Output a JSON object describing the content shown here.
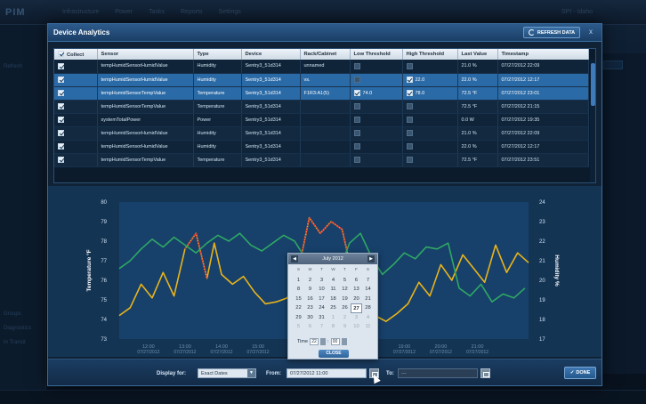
{
  "background": {
    "logo": "PIM",
    "tabs": [
      "Infrastructure",
      "Power",
      "Tasks",
      "Reports",
      "Settings"
    ],
    "user": "SPI - Idaho",
    "sidebar_items": [
      "Refresh",
      "Groups",
      "Diagnostics",
      "In Transit"
    ]
  },
  "modal": {
    "title": "Device Analytics",
    "refresh_label": "REFRESH DATA",
    "close_label": "x"
  },
  "table": {
    "headers": [
      "Collect",
      "Sensor",
      "Type",
      "Device",
      "Rack/Cabinet",
      "Low Threshold",
      "High Threshold",
      "Last Value",
      "Timestamp"
    ],
    "rows": [
      {
        "collect": true,
        "sensor": "tempHumidSensorHumidValue",
        "type": "Humidity",
        "device": "Sentry3_51d314",
        "rack": "unnamed",
        "low_on": false,
        "low": "",
        "high_on": false,
        "high": "",
        "last": "21.0 %",
        "time": "07/27/2012 22:09",
        "selected": false
      },
      {
        "collect": true,
        "sensor": "tempHumidSensorHumidValue",
        "type": "Humidity",
        "device": "Sentry3_51d314",
        "rack": "vs.",
        "low_on": false,
        "low": "",
        "high_on": true,
        "high": "22.0",
        "last": "22.0 %",
        "time": "07/27/2012 12:17",
        "selected": true
      },
      {
        "collect": true,
        "sensor": "tempHumidSensorTempValue",
        "type": "Temperature",
        "device": "Sentry3_51d314",
        "rack": "F1R3:A1(5)",
        "low_on": true,
        "low": "74.0",
        "high_on": true,
        "high": "78.0",
        "last": "72.5 °F",
        "time": "07/27/2012 23:01",
        "selected": true
      },
      {
        "collect": true,
        "sensor": "tempHumidSensorTempValue",
        "type": "Temperature",
        "device": "Sentry3_51d314",
        "rack": "",
        "low_on": false,
        "low": "",
        "high_on": false,
        "high": "",
        "last": "72.5 °F",
        "time": "07/27/2012 21:15",
        "selected": false
      },
      {
        "collect": true,
        "sensor": "systemTotalPower",
        "type": "Power",
        "device": "Sentry3_51d314",
        "rack": "",
        "low_on": false,
        "low": "",
        "high_on": false,
        "high": "",
        "last": "0.0 W",
        "time": "07/27/2012 19:35",
        "selected": false
      },
      {
        "collect": true,
        "sensor": "tempHumidSensorHumidValue",
        "type": "Humidity",
        "device": "Sentry3_51d314",
        "rack": "",
        "low_on": false,
        "low": "",
        "high_on": false,
        "high": "",
        "last": "21.0 %",
        "time": "07/27/2012 22:09",
        "selected": false
      },
      {
        "collect": true,
        "sensor": "tempHumidSensorHumidValue",
        "type": "Humidity",
        "device": "Sentry3_51d314",
        "rack": "",
        "low_on": false,
        "low": "",
        "high_on": false,
        "high": "",
        "last": "22.0 %",
        "time": "07/27/2012 12:17",
        "selected": false
      },
      {
        "collect": true,
        "sensor": "tempHumidSensorTempValue",
        "type": "Temperature",
        "device": "Sentry3_51d314",
        "rack": "",
        "low_on": false,
        "low": "",
        "high_on": false,
        "high": "",
        "last": "72.5 °F",
        "time": "07/27/2012 23:51",
        "selected": false
      }
    ]
  },
  "chart_data": {
    "type": "line",
    "ylabel": "Temperature °F",
    "y2label": "Humidity %",
    "ylim": [
      73,
      80
    ],
    "y2lim": [
      17,
      24
    ],
    "yticks": [
      73,
      74,
      75,
      76,
      77,
      78,
      79,
      80
    ],
    "y2ticks": [
      17,
      18,
      19,
      20,
      21,
      22,
      23,
      24
    ],
    "xticks": [
      {
        "t": 12.0,
        "time": "12:00",
        "date": "07/27/2012"
      },
      {
        "t": 13.0,
        "time": "13:00",
        "date": "07/27/2012"
      },
      {
        "t": 14.0,
        "time": "14:00",
        "date": "07/27/2012"
      },
      {
        "t": 15.0,
        "time": "15:00",
        "date": "07/27/2012"
      },
      {
        "t": 19.0,
        "time": "19:00",
        "date": "07/27/2012"
      },
      {
        "t": 20.0,
        "time": "20:00",
        "date": "07/27/2012"
      },
      {
        "t": 21.0,
        "time": "21:00",
        "date": "07/27/2012"
      }
    ],
    "xlim": [
      11.2,
      22.4
    ],
    "series": [
      {
        "name": "tempHumidSensorTempValue",
        "axis": "left",
        "color": "#e8b41c",
        "x": [
          11.2,
          11.5,
          11.8,
          12.1,
          12.4,
          12.7,
          13.0,
          13.3,
          13.6,
          13.8,
          14.0,
          14.3,
          14.6,
          14.9,
          15.2,
          15.5,
          15.8,
          16.1,
          16.4,
          16.7,
          17.0,
          17.3,
          17.6,
          17.9,
          18.2,
          18.5,
          18.8,
          19.1,
          19.4,
          19.7,
          20.0,
          20.3,
          20.6,
          20.9,
          21.2,
          21.5,
          21.8,
          22.1,
          22.4
        ],
        "y": [
          74.2,
          74.6,
          75.8,
          75.1,
          76.4,
          75.2,
          77.6,
          78.4,
          76.1,
          77.9,
          76.3,
          75.8,
          76.2,
          75.4,
          74.8,
          74.9,
          75.1,
          76.5,
          79.2,
          78.4,
          79.0,
          78.6,
          76.1,
          75.4,
          74.2,
          73.9,
          74.3,
          74.8,
          75.9,
          75.2,
          76.8,
          76.0,
          77.3,
          76.6,
          75.9,
          77.8,
          76.4,
          77.4,
          76.9
        ]
      },
      {
        "name": "tempHumidSensorHumidValue",
        "axis": "right",
        "color": "#2fa864",
        "x": [
          11.2,
          11.5,
          11.8,
          12.1,
          12.4,
          12.7,
          13.0,
          13.3,
          13.6,
          13.9,
          14.2,
          14.5,
          14.8,
          15.1,
          15.4,
          15.7,
          16.0,
          16.3,
          16.6,
          16.9,
          17.2,
          17.5,
          17.8,
          18.1,
          18.4,
          18.7,
          19.0,
          19.3,
          19.6,
          19.9,
          20.2,
          20.5,
          20.8,
          21.1,
          21.4,
          21.7,
          22.0,
          22.3
        ],
        "y": [
          20.6,
          21.0,
          21.6,
          22.1,
          21.7,
          22.2,
          21.8,
          21.4,
          21.9,
          22.3,
          22.0,
          22.4,
          21.8,
          21.5,
          21.9,
          22.3,
          22.0,
          21.1,
          20.2,
          20.0,
          20.4,
          21.9,
          22.4,
          21.2,
          20.3,
          20.8,
          21.4,
          21.1,
          21.7,
          21.6,
          21.9,
          19.6,
          19.2,
          19.8,
          18.9,
          19.3,
          19.1,
          19.6
        ]
      }
    ],
    "threshold_exceed_color": "#d8263f",
    "legend": [
      "tempHumidSensorTempValue",
      "tempHumidSensorHumidValue"
    ]
  },
  "datepicker": {
    "month": "July 2012",
    "dow": [
      "S",
      "M",
      "T",
      "W",
      "T",
      "F",
      "S"
    ],
    "days": [
      {
        "d": "1",
        "m": false
      },
      {
        "d": "2",
        "m": false
      },
      {
        "d": "3",
        "m": false
      },
      {
        "d": "4",
        "m": false
      },
      {
        "d": "5",
        "m": false
      },
      {
        "d": "6",
        "m": false
      },
      {
        "d": "7",
        "m": false
      },
      {
        "d": "8",
        "m": false
      },
      {
        "d": "9",
        "m": false
      },
      {
        "d": "10",
        "m": false
      },
      {
        "d": "11",
        "m": false
      },
      {
        "d": "12",
        "m": false
      },
      {
        "d": "13",
        "m": false
      },
      {
        "d": "14",
        "m": false
      },
      {
        "d": "15",
        "m": false
      },
      {
        "d": "16",
        "m": false
      },
      {
        "d": "17",
        "m": false
      },
      {
        "d": "18",
        "m": false
      },
      {
        "d": "19",
        "m": false
      },
      {
        "d": "20",
        "m": false
      },
      {
        "d": "21",
        "m": false
      },
      {
        "d": "22",
        "m": false
      },
      {
        "d": "23",
        "m": false
      },
      {
        "d": "24",
        "m": false
      },
      {
        "d": "25",
        "m": false
      },
      {
        "d": "26",
        "m": false
      },
      {
        "d": "27",
        "m": false,
        "today": true
      },
      {
        "d": "28",
        "m": false
      },
      {
        "d": "29",
        "m": false
      },
      {
        "d": "30",
        "m": false
      },
      {
        "d": "31",
        "m": false
      },
      {
        "d": "1",
        "m": true
      },
      {
        "d": "2",
        "m": true
      },
      {
        "d": "3",
        "m": true
      },
      {
        "d": "4",
        "m": true
      },
      {
        "d": "5",
        "m": true
      },
      {
        "d": "6",
        "m": true
      },
      {
        "d": "7",
        "m": true
      },
      {
        "d": "8",
        "m": true
      },
      {
        "d": "9",
        "m": true
      },
      {
        "d": "10",
        "m": true
      },
      {
        "d": "11",
        "m": true
      }
    ],
    "time_label": "Time",
    "hour": "22",
    "minute": "00",
    "close_label": "CLOSE"
  },
  "footer": {
    "display_label": "Display for:",
    "display_value": "Exact Dates",
    "from_label": "From:",
    "from_value": "07/27/2012 11:00",
    "to_label": "To:",
    "to_value": "---",
    "done_label": "DONE"
  }
}
